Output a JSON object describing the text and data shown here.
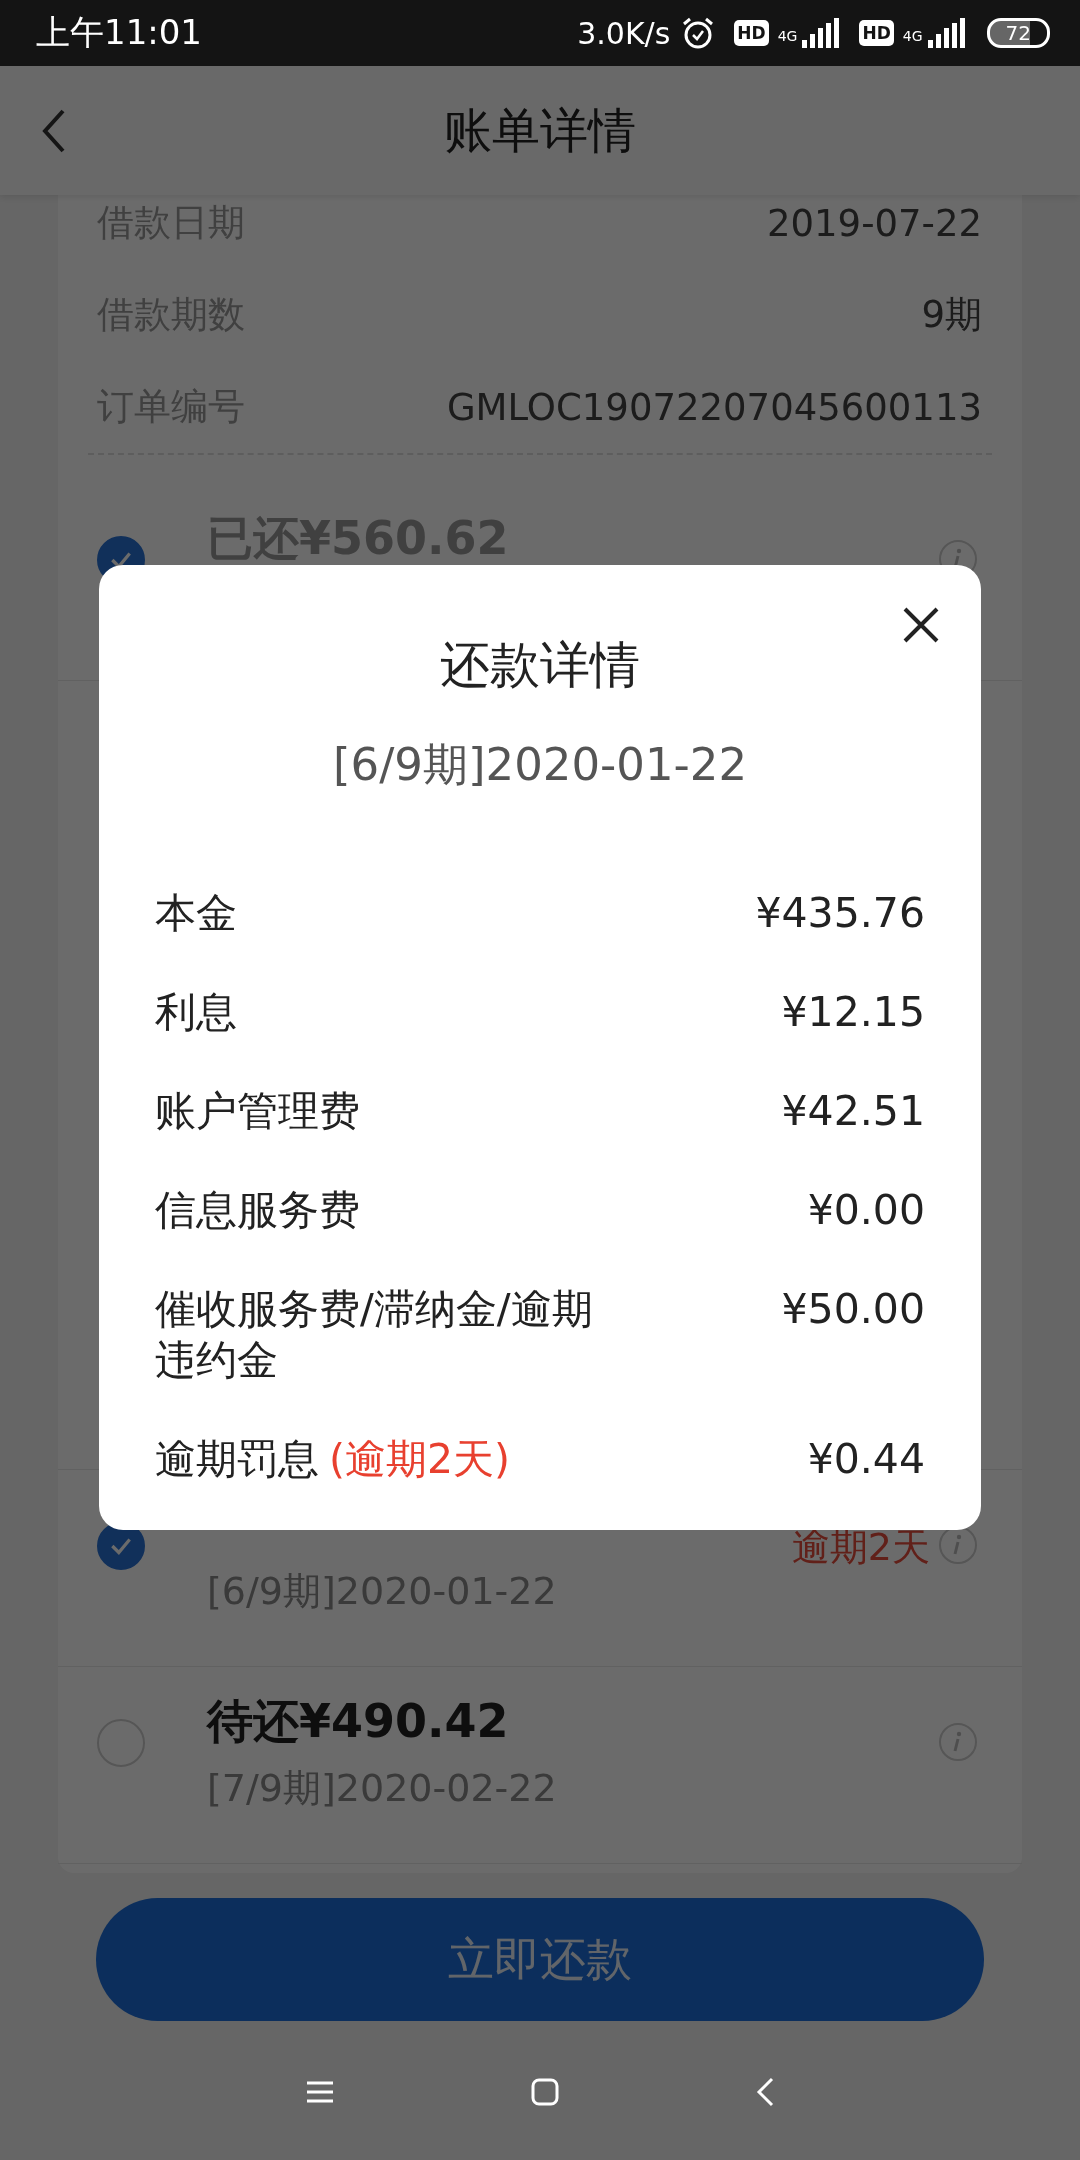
{
  "status_bar": {
    "time": "上午11:01",
    "speed": "3.0K/s",
    "sims": [
      {
        "hd": "HD",
        "net": "4G"
      },
      {
        "hd": "HD",
        "net": "4G"
      }
    ],
    "battery": "72"
  },
  "header": {
    "title": "账单详情"
  },
  "loan_info": [
    {
      "label": "借款日期",
      "value": "2019-07-22"
    },
    {
      "label": "借款期数",
      "value": "9期"
    },
    {
      "label": "订单编号",
      "value": "GMLOC19072207045600113"
    }
  ],
  "installments_top": [
    {
      "title": "已还¥560.62",
      "checked": true,
      "paid": true
    }
  ],
  "installments_bottom": [
    {
      "date": "[6/9期]2020-01-22",
      "checked": true,
      "overdue": "逾期2天"
    },
    {
      "title": "待还¥490.42",
      "date": "[7/9期]2020-02-22",
      "checked": false
    }
  ],
  "pay_button": "立即还款",
  "modal": {
    "title": "还款详情",
    "subtitle": "[6/9期]2020-01-22",
    "rows": [
      {
        "label": "本金",
        "value": "¥435.76"
      },
      {
        "label": "利息",
        "value": "¥12.15"
      },
      {
        "label": "账户管理费",
        "value": "¥42.51"
      },
      {
        "label": "信息服务费",
        "value": "¥0.00"
      },
      {
        "label": "催收服务费/滞纳金/逾期违约金",
        "value": "¥50.00"
      },
      {
        "label": "逾期罚息",
        "note": "(逾期2天)",
        "value": "¥0.44"
      }
    ]
  }
}
